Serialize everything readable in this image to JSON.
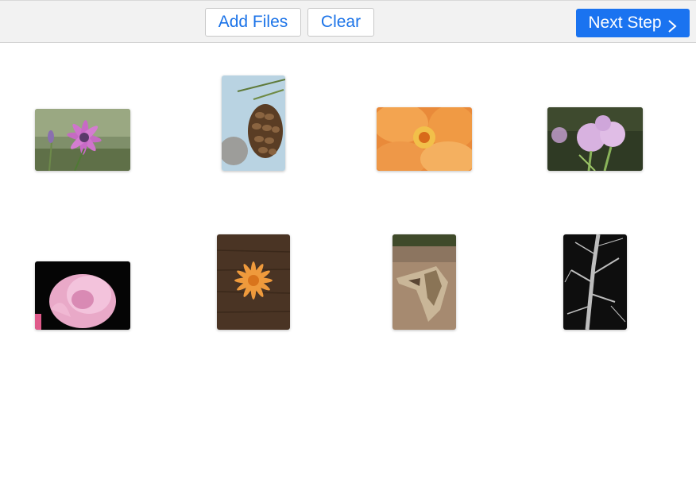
{
  "toolbar": {
    "add_files_label": "Add Files",
    "clear_label": "Clear",
    "next_step_label": "Next Step"
  },
  "colors": {
    "accent": "#1a73f0",
    "link_text": "#1b73e8",
    "toolbar_bg": "#f2f2f2"
  },
  "thumbnails": [
    {
      "subject": "purple daisy",
      "orientation": "landscape"
    },
    {
      "subject": "pine cone",
      "orientation": "portrait"
    },
    {
      "subject": "orange rose",
      "orientation": "landscape"
    },
    {
      "subject": "pink thistle flowers",
      "orientation": "landscape"
    },
    {
      "subject": "pink rose",
      "orientation": "landscape"
    },
    {
      "subject": "orange flower on wood",
      "orientation": "portrait"
    },
    {
      "subject": "driftwood on sand",
      "orientation": "portrait"
    },
    {
      "subject": "bare tree branches black and white",
      "orientation": "portrait"
    }
  ]
}
